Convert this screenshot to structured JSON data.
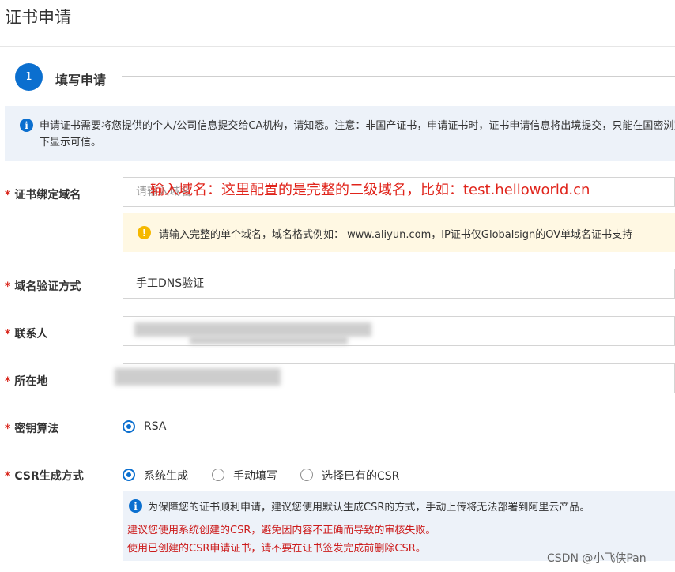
{
  "page": {
    "title": "证书申请"
  },
  "step": {
    "number": "1",
    "label": "填写申请"
  },
  "notice": {
    "text": "申请证书需要将您提供的个人/公司信息提交给CA机构，请知悉。注意：非国产证书，申请证书时，证书申请信息将出境提交，只能在国密浏览器下显示可信。"
  },
  "form": {
    "domain": {
      "label": "证书绑定域名",
      "placeholder": "请输入域名",
      "annotation": "输入域名：这里配置的是完整的二级域名，比如：test.helloworld.cn",
      "hint": "请输入完整的单个域名，域名格式例如： www.aliyun.com，IP证书仅Globalsign的OV单域名证书支持"
    },
    "verify": {
      "label": "域名验证方式",
      "value": "手工DNS验证"
    },
    "contact": {
      "label": "联系人"
    },
    "location": {
      "label": "所在地"
    },
    "algorithm": {
      "label": "密钥算法",
      "option": "RSA"
    },
    "csr": {
      "label": "CSR生成方式",
      "options": [
        "系统生成",
        "手动填写",
        "选择已有的CSR"
      ],
      "selected": "系统生成",
      "info": "为保障您的证书顺利申请，建议您使用默认生成CSR的方式，手动上传将无法部署到阿里云产品。",
      "warning1": "建议您使用系统创建的CSR，避免因内容不正确而导致的审核失败。",
      "warning2": "使用已创建的CSR申请证书，请不要在证书签发完成前删除CSR。"
    },
    "required_mark": "*"
  },
  "watermark": "CSDN @小飞侠Pan",
  "colors": {
    "accent": "#0b6fcf",
    "required": "#d9261c",
    "warning_bg": "#fff8e3",
    "info_bg": "#edf2f9"
  },
  "icons": {
    "info": "info-circle-icon",
    "warning": "warning-circle-icon"
  }
}
